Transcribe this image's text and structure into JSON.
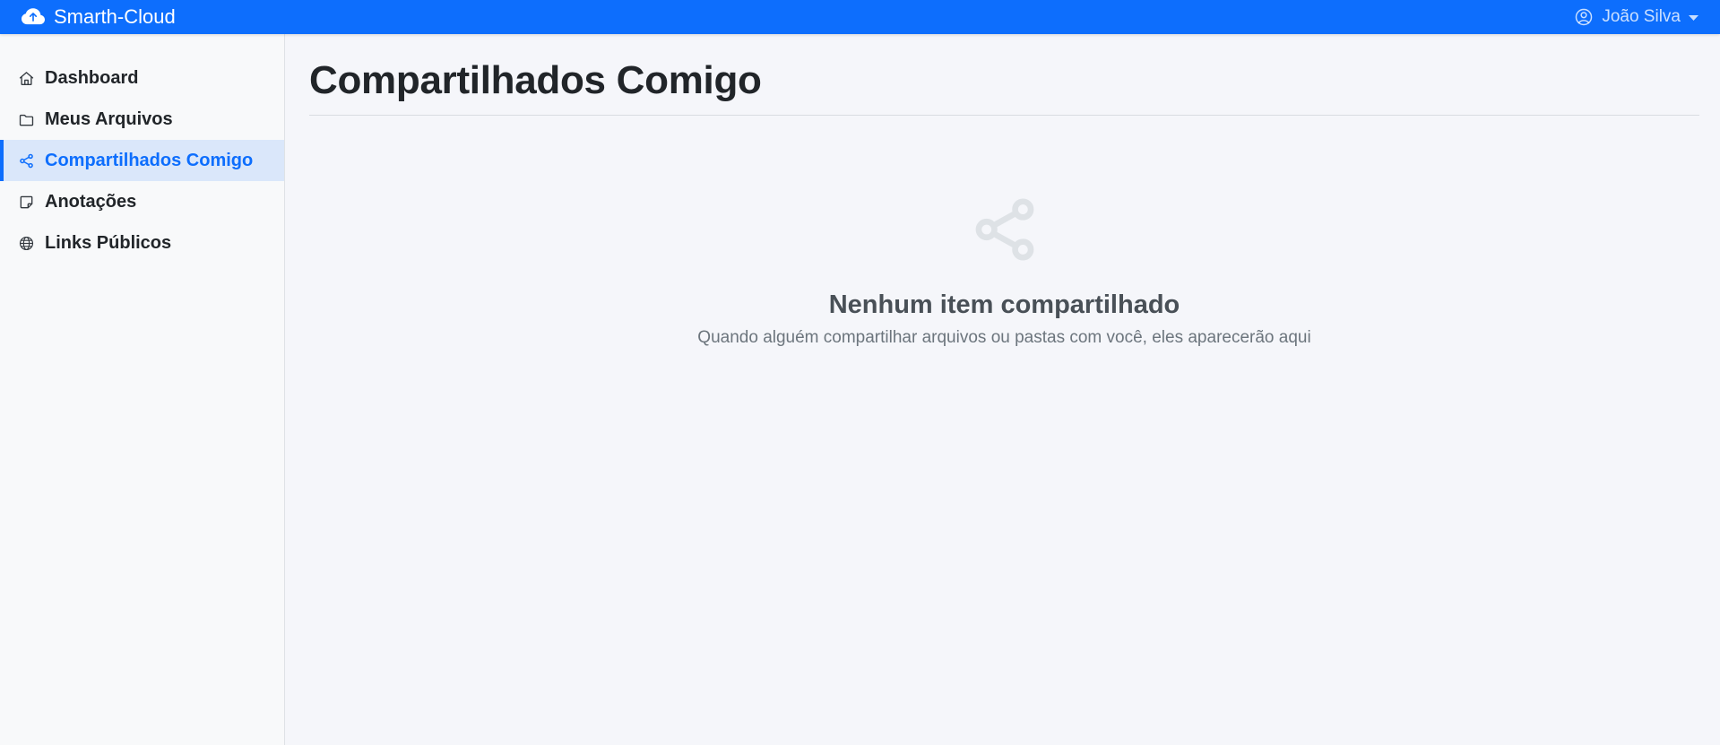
{
  "navbar": {
    "brand": "Smarth-Cloud",
    "brand_icon": "cloud-upload-icon",
    "user": {
      "name": "João Silva",
      "icon": "person-circle-icon"
    }
  },
  "sidebar": {
    "items": [
      {
        "id": "dashboard",
        "label": "Dashboard",
        "icon": "house-icon",
        "active": false
      },
      {
        "id": "meus-arquivos",
        "label": "Meus Arquivos",
        "icon": "folder-icon",
        "active": false
      },
      {
        "id": "compartilhados-comigo",
        "label": "Compartilhados Comigo",
        "icon": "share-icon",
        "active": true
      },
      {
        "id": "anotacoes",
        "label": "Anotações",
        "icon": "note-icon",
        "active": false
      },
      {
        "id": "links-publicos",
        "label": "Links Públicos",
        "icon": "globe-icon",
        "active": false
      }
    ]
  },
  "main": {
    "title": "Compartilhados Comigo",
    "empty_state": {
      "icon": "share-icon",
      "title": "Nenhum item compartilhado",
      "subtitle": "Quando alguém compartilhar arquivos ou pastas com você, eles aparecerão aqui"
    }
  },
  "theme": {
    "navbar_bg": "#0d6efd",
    "accent": "#0d6efd",
    "active_item_bg": "#dae7fa",
    "sidebar_bg": "#f8f9fa",
    "main_bg": "#f5f6fa",
    "border": "#dee2e6",
    "empty_icon": "#dee2e6",
    "empty_title_color": "#495057",
    "empty_subtitle_color": "#6c757d"
  }
}
